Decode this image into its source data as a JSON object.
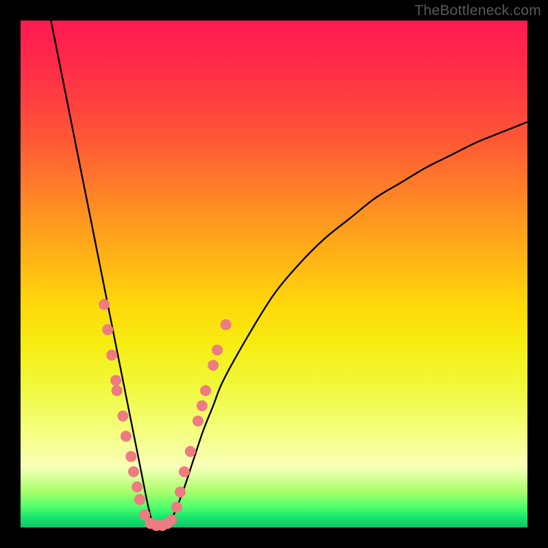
{
  "watermark": "TheBottleneck.com",
  "colors": {
    "background": "#000000",
    "curve_stroke": "#000000",
    "dot_fill": "#ee7b81",
    "gradient_top": "#ff1a52",
    "gradient_bottom": "#0fc268"
  },
  "chart_data": {
    "type": "line",
    "title": "",
    "xlabel": "",
    "ylabel": "",
    "xlim": [
      0,
      100
    ],
    "ylim": [
      0,
      100
    ],
    "grid": false,
    "legend": false,
    "notes": "V-shaped bottleneck curve on rainbow background; y represents bottleneck percentage (0 at bottom = optimal). No axes, ticks, or labels are rendered.",
    "series": [
      {
        "name": "bottleneck-curve",
        "x": [
          6,
          8,
          10,
          12,
          14,
          16,
          18,
          20,
          21,
          22,
          23,
          24,
          25,
          26,
          27,
          28,
          29,
          30,
          32,
          34,
          36,
          38,
          40,
          45,
          50,
          55,
          60,
          65,
          70,
          75,
          80,
          85,
          90,
          95,
          100
        ],
        "y": [
          100,
          90,
          80,
          70,
          60,
          50,
          40,
          30,
          25,
          20,
          15,
          10,
          5,
          1,
          0,
          0,
          0,
          2,
          7,
          13,
          19,
          24,
          29,
          38,
          46,
          52,
          57,
          61,
          65,
          68,
          71,
          73.5,
          76,
          78,
          80
        ]
      }
    ],
    "dots": {
      "name": "highlighted-points",
      "note": "Salmon dots clustered on both arms near the valley; y is approximate bottleneck value.",
      "points": [
        {
          "x": 16.5,
          "y": 44
        },
        {
          "x": 17.2,
          "y": 39
        },
        {
          "x": 18.0,
          "y": 34
        },
        {
          "x": 18.8,
          "y": 29
        },
        {
          "x": 19.0,
          "y": 27
        },
        {
          "x": 20.2,
          "y": 22
        },
        {
          "x": 20.8,
          "y": 18
        },
        {
          "x": 21.8,
          "y": 14
        },
        {
          "x": 22.3,
          "y": 11
        },
        {
          "x": 23.0,
          "y": 8
        },
        {
          "x": 23.5,
          "y": 5.5
        },
        {
          "x": 24.5,
          "y": 2.5
        },
        {
          "x": 25.6,
          "y": 0.8
        },
        {
          "x": 26.8,
          "y": 0.4
        },
        {
          "x": 28.0,
          "y": 0.4
        },
        {
          "x": 29.0,
          "y": 0.8
        },
        {
          "x": 29.8,
          "y": 1.5
        },
        {
          "x": 30.8,
          "y": 4
        },
        {
          "x": 31.5,
          "y": 7
        },
        {
          "x": 32.3,
          "y": 11
        },
        {
          "x": 33.5,
          "y": 15
        },
        {
          "x": 35.0,
          "y": 21
        },
        {
          "x": 35.8,
          "y": 24
        },
        {
          "x": 36.5,
          "y": 27
        },
        {
          "x": 38.0,
          "y": 32
        },
        {
          "x": 38.8,
          "y": 35
        },
        {
          "x": 40.5,
          "y": 40
        }
      ]
    }
  }
}
